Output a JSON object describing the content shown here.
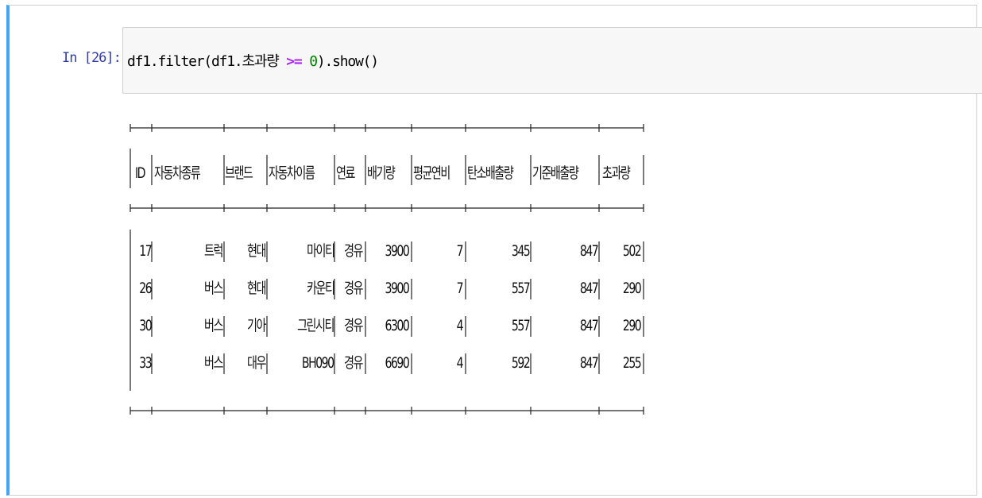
{
  "cell": {
    "prompt": "In [26]:",
    "code": {
      "prefix": "df1.filter(df1.초과량 ",
      "operator": ">=",
      "space": " ",
      "number": "0",
      "suffix": ").show()"
    }
  },
  "output": {
    "columns": [
      "ID",
      "자동차종류",
      "브랜드",
      "자동차이름",
      "연료",
      "배기량",
      "평균연비",
      "탄소배출량",
      "기준배출량",
      "초과량"
    ],
    "rows": [
      [
        "17",
        "트럭",
        "현대",
        "마이티",
        "경유",
        "3900",
        "7",
        "345",
        "847",
        "502"
      ],
      [
        "26",
        "버스",
        "현대",
        "카운티",
        "경유",
        "3900",
        "7",
        "557",
        "847",
        "290"
      ],
      [
        "30",
        "버스",
        "기아",
        "그린시티",
        "경유",
        "6300",
        "4",
        "557",
        "847",
        "290"
      ],
      [
        "33",
        "버스",
        "대우",
        "BH090",
        "경유",
        "6690",
        "4",
        "592",
        "847",
        "255"
      ]
    ]
  },
  "colors": {
    "prompt": "#303f9f",
    "cell_border_active": "#42a5f5",
    "code_background": "#f7f7f7",
    "operator": "#aa22ff",
    "number": "#008000"
  }
}
